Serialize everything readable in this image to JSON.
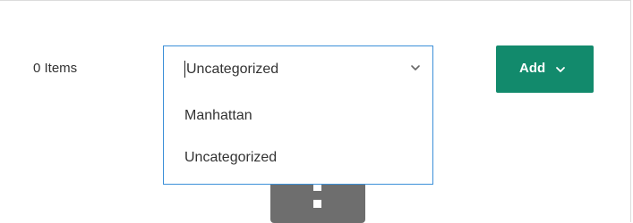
{
  "items_count": "0 Items",
  "category_select": {
    "selected_value": "Uncategorized",
    "options": [
      "Manhattan",
      "Uncategorized"
    ],
    "icon": "chevron-down-icon"
  },
  "add_button": {
    "label": "Add",
    "icon": "chevron-down-icon"
  },
  "drag_handle": {
    "icon": "drag-handle-icon"
  },
  "colors": {
    "accent": "#128a6c",
    "focus_border": "#3b8fd8",
    "text": "#333333",
    "handle": "#6e6e6e"
  }
}
